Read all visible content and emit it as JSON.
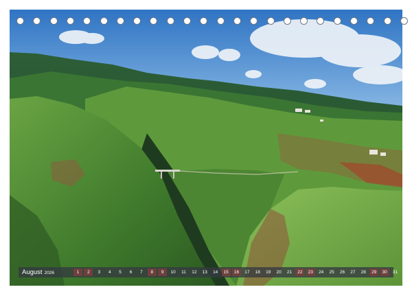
{
  "calendar": {
    "month": "August",
    "year": "2026",
    "days": [
      "1",
      "2",
      "3",
      "4",
      "5",
      "6",
      "7",
      "8",
      "9",
      "10",
      "11",
      "12",
      "13",
      "14",
      "15",
      "16",
      "17",
      "18",
      "19",
      "20",
      "21",
      "22",
      "23",
      "24",
      "25",
      "26",
      "27",
      "28",
      "29",
      "30",
      "31"
    ],
    "weekend_days": [
      "1",
      "2",
      "8",
      "9",
      "15",
      "16",
      "22",
      "23",
      "29",
      "30"
    ]
  },
  "colors": {
    "sky": "#3f86d1",
    "strip": "#343a40",
    "weekend": "#783e3e",
    "vegetation": "#4f8a33"
  }
}
